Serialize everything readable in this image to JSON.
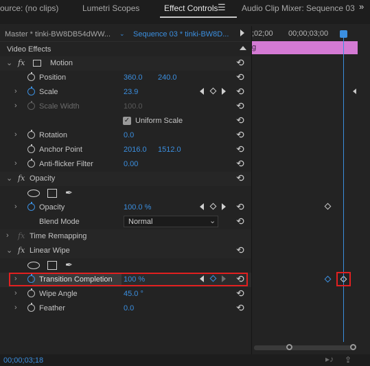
{
  "tabs": [
    {
      "label": "ource: (no clips)"
    },
    {
      "label": "Lumetri Scopes"
    },
    {
      "label": "Effect Controls"
    },
    {
      "label": "Audio Clip Mixer: Sequence 03"
    }
  ],
  "tab_menu_icon": "hamburger-icon",
  "overflow_icon": "double-chevron-right-icon",
  "source_selector": {
    "master": "Master * tinki-BW8DB54dWW...",
    "sequence": "Sequence 03 * tinki-BW8D..."
  },
  "timeline": {
    "tc_left": ";02;00",
    "tc_right": "00;00;03;00",
    "clip_label": "g",
    "current_time": "00;00;03;18"
  },
  "video_effects_label": "Video Effects",
  "motion": {
    "name": "Motion",
    "position": {
      "label": "Position",
      "x": "360.0",
      "y": "240.0"
    },
    "scale": {
      "label": "Scale",
      "value": "23.9"
    },
    "scale_width": {
      "label": "Scale Width",
      "value": "100.0"
    },
    "uniform_scale": {
      "label": "Uniform Scale",
      "checked": true
    },
    "rotation": {
      "label": "Rotation",
      "value": "0.0"
    },
    "anchor_point": {
      "label": "Anchor Point",
      "x": "2016.0",
      "y": "1512.0"
    },
    "anti_flicker": {
      "label": "Anti-flicker Filter",
      "value": "0.00"
    }
  },
  "opacity": {
    "name": "Opacity",
    "opacity": {
      "label": "Opacity",
      "value": "100.0 %"
    },
    "blend_mode": {
      "label": "Blend Mode",
      "value": "Normal"
    }
  },
  "time_remapping": {
    "name": "Time Remapping"
  },
  "linear_wipe": {
    "name": "Linear Wipe",
    "transition_completion": {
      "label": "Transition Completion",
      "value": "100 %"
    },
    "wipe_angle": {
      "label": "Wipe Angle",
      "value": "45.0 °"
    },
    "feather": {
      "label": "Feather",
      "value": "0.0"
    }
  },
  "colors": {
    "accent": "#3b8fe0",
    "clip": "#d47ad4",
    "highlight": "#e22020",
    "panel": "#232323"
  }
}
